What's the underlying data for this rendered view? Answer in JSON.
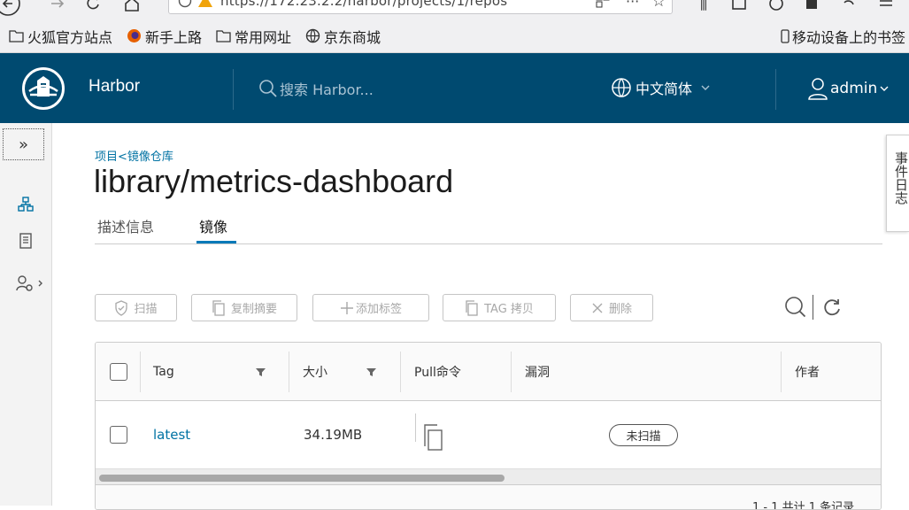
{
  "browser": {
    "url": "https://172.23.2.2/harbor/projects/1/repos",
    "bookmarks": [
      "火狐官方站点",
      "新手上路",
      "常用网址",
      "京东商城"
    ],
    "mobile_bookmarks": "移动设备上的书签"
  },
  "header": {
    "brand": "Harbor",
    "search_placeholder": "搜索 Harbor...",
    "language": "中文简体",
    "user": "admin"
  },
  "breadcrumb": "项目<镜像仓库",
  "page_title": "library/metrics-dashboard",
  "tabs": [
    "描述信息",
    "镜像"
  ],
  "active_tab": "镜像",
  "toolbar": {
    "scan": "扫描",
    "copy_digest": "复制摘要",
    "add_label": "添加标签",
    "tag_copy": "TAG 拷贝",
    "delete": "删除"
  },
  "table": {
    "columns": [
      "Tag",
      "大小",
      "Pull命令",
      "漏洞",
      "作者"
    ],
    "rows": [
      {
        "tag": "latest",
        "size": "34.19MB",
        "vulnerability": "未扫描"
      }
    ],
    "footer": "1 - 1 共计 1 条记录"
  },
  "side_panel_label": "事件日志",
  "colors": {
    "header_bg": "#004a70",
    "link": "#0072a3",
    "tab_active": "#0079b8"
  }
}
